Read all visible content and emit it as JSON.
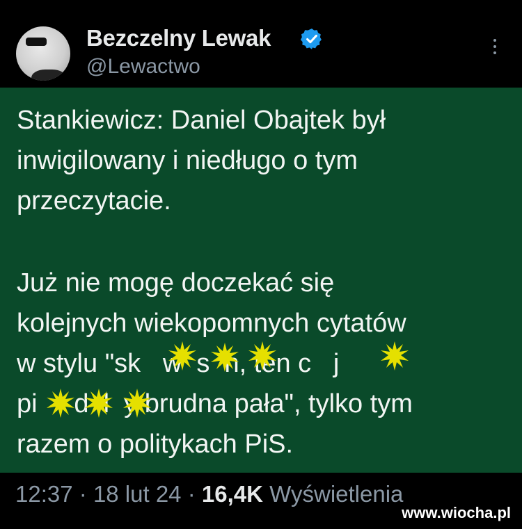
{
  "header": {
    "display_name": "Bezczelny Lewak",
    "handle": "@Lewactwo",
    "verified_icon": "verified-badge-icon",
    "more_icon": "more-options-icon"
  },
  "tweet": {
    "paragraph1": "Stankiewicz: Daniel Obajtek był inwigilowany i niedługo o tym przeczytacie.",
    "p2_line1": "Już nie mogę doczekać się",
    "p2_line2": "kolejnych wiekopomnych cytatów",
    "p2_line3": "w stylu \"sk   w  s  n, ten c   j",
    "p2_line4": "pi     d  l  y brudna pała\", tylko tym",
    "p2_line5": "razem o politykach PiS.",
    "background_color": "#0a4a2a",
    "censor_icon": "censor-star-icon"
  },
  "footer": {
    "time": "12:37",
    "sep1": "·",
    "date": "18 lut 24",
    "sep2": "·",
    "views_count": "16,4K",
    "views_label": "Wyświetlenia"
  },
  "watermark": "www.wiocha.pl",
  "colors": {
    "accent_blue": "#1d9bf0",
    "censor_yellow": "#e5e000"
  }
}
